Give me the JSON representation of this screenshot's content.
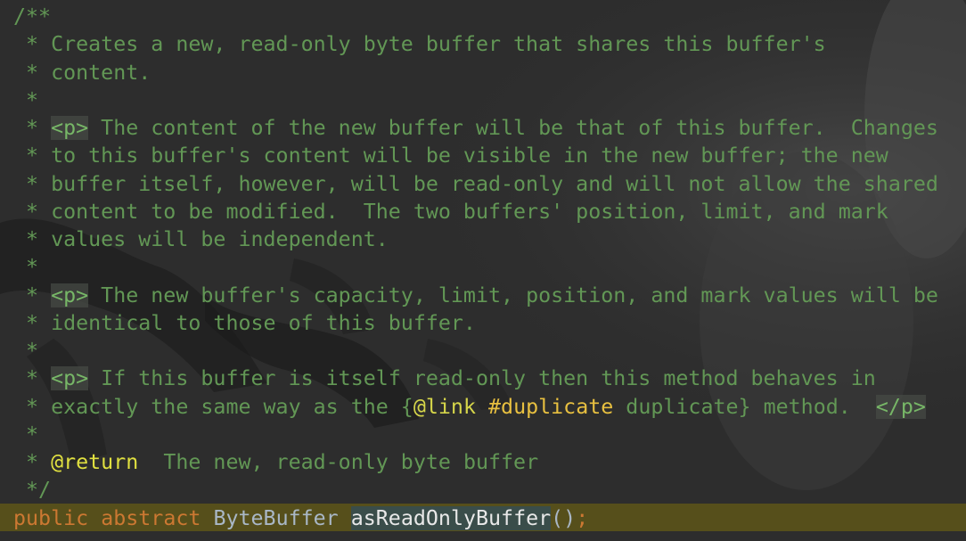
{
  "editor": {
    "language": "java",
    "colors": {
      "comment": "#629755",
      "keyword": "#cc7832",
      "caret_line": "#625816",
      "javadoc_tag": "#e0e040"
    }
  },
  "lines": [
    [
      {
        "cls": "c",
        "text": "/**"
      }
    ],
    [
      {
        "cls": "c",
        "text": " * Creates a new, read-only byte buffer that shares this buffer's"
      }
    ],
    [
      {
        "cls": "c",
        "text": " * content."
      }
    ],
    [
      {
        "cls": "c",
        "text": " *"
      }
    ],
    [
      {
        "cls": "c",
        "text": " * "
      },
      {
        "cls": "c-tag",
        "text": "<p>"
      },
      {
        "cls": "c",
        "text": " The content of the new buffer will be that of this buffer.  Changes"
      }
    ],
    [
      {
        "cls": "c",
        "text": " * to this buffer's content will be visible in the new buffer; the new"
      }
    ],
    [
      {
        "cls": "c",
        "text": " * buffer itself, however, will be read-only and will not allow the shared"
      }
    ],
    [
      {
        "cls": "c",
        "text": " * content to be modified.  The two buffers' position, limit, and mark"
      }
    ],
    [
      {
        "cls": "c",
        "text": " * values will be independent."
      }
    ],
    [
      {
        "cls": "c",
        "text": " *"
      }
    ],
    [
      {
        "cls": "c",
        "text": " * "
      },
      {
        "cls": "c-tag",
        "text": "<p>"
      },
      {
        "cls": "c",
        "text": " The new buffer's capacity, limit, position, and mark values will be"
      }
    ],
    [
      {
        "cls": "c",
        "text": " * identical to those of this buffer."
      }
    ],
    [
      {
        "cls": "c",
        "text": " *"
      }
    ],
    [
      {
        "cls": "c",
        "text": " * "
      },
      {
        "cls": "c-tag",
        "text": "<p>"
      },
      {
        "cls": "c",
        "text": " If this buffer is itself read-only then this method behaves in"
      }
    ],
    [
      {
        "cls": "c",
        "text": " * exactly the same way as the {"
      },
      {
        "cls": "c-link",
        "text": "@link"
      },
      {
        "cls": "c",
        "text": " "
      },
      {
        "cls": "c-ref",
        "text": "#duplicate"
      },
      {
        "cls": "c",
        "text": " duplicate} method.  "
      },
      {
        "cls": "c-tag",
        "text": "</p>"
      }
    ],
    [
      {
        "cls": "c",
        "text": " *"
      }
    ],
    [
      {
        "cls": "c",
        "text": " * "
      },
      {
        "cls": "c-ann",
        "text": "@return"
      },
      {
        "cls": "c",
        "text": "  The new, read-only byte buffer"
      }
    ],
    [
      {
        "cls": "c",
        "text": " */"
      }
    ],
    [
      {
        "cls": "kw",
        "text": "public"
      },
      {
        "cls": "punct",
        "text": " "
      },
      {
        "cls": "kw",
        "text": "abstract"
      },
      {
        "cls": "punct",
        "text": " "
      },
      {
        "cls": "type",
        "text": "ByteBuffer"
      },
      {
        "cls": "punct",
        "text": " "
      },
      {
        "cls": "ident",
        "text": "asReadOnlyBuffer"
      },
      {
        "cls": "punct",
        "text": "()"
      },
      {
        "cls": "semi",
        "text": ";"
      }
    ]
  ]
}
